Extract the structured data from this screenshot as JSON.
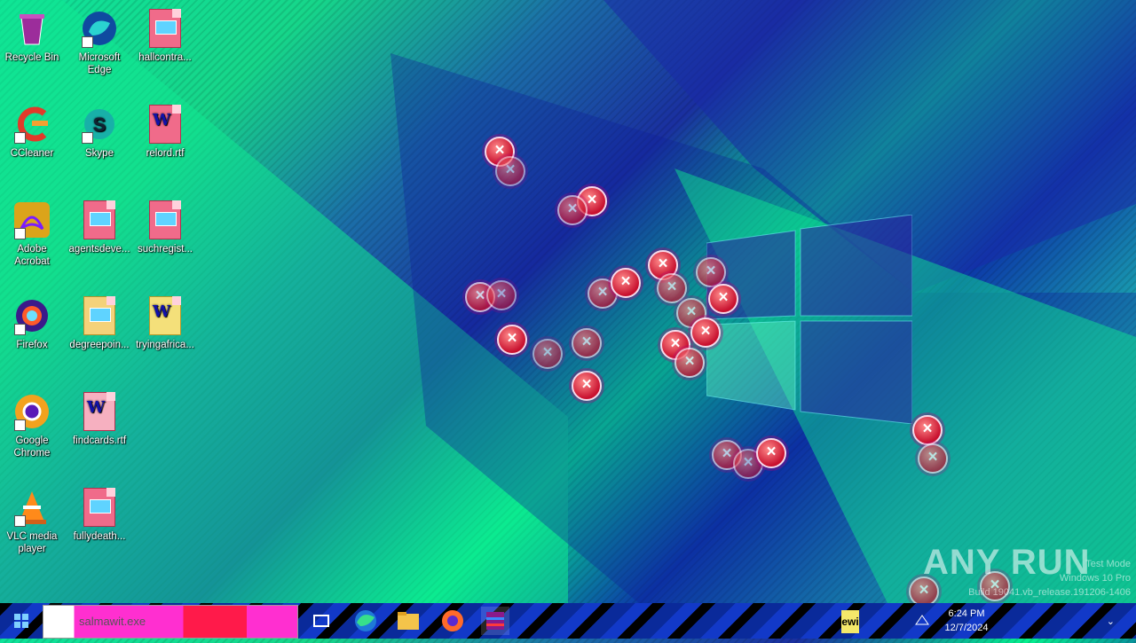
{
  "desktop": {
    "icons": [
      {
        "label": "Recycle Bin"
      },
      {
        "label": "Microsoft Edge"
      },
      {
        "label": "hallcontra..."
      },
      {
        "label": "CCleaner"
      },
      {
        "label": "Skype"
      },
      {
        "label": "relord.rtf"
      },
      {
        "label": "Adobe Acrobat"
      },
      {
        "label": "agentsdeve..."
      },
      {
        "label": "suchregist..."
      },
      {
        "label": "Firefox"
      },
      {
        "label": "degreepoin..."
      },
      {
        "label": "tryingafrica..."
      },
      {
        "label": "Google Chrome"
      },
      {
        "label": "findcards.rtf"
      },
      {
        "label": "VLC media player"
      },
      {
        "label": "fullydeath..."
      }
    ],
    "error_symbol": "×"
  },
  "taskbar": {
    "search_placeholder": "salmawit.exe",
    "pinned": [
      "task-view",
      "microsoft-edge",
      "file-explorer",
      "firefox",
      "winrar"
    ],
    "tray_label": "ewi",
    "time": "6:24 PM",
    "date": "12/7/2024"
  },
  "watermark": {
    "text": "ANY RUN",
    "mode_line": "Test Mode",
    "os_line": "Windows 10 Pro",
    "build_line": "Build 19041.vb_release.191206-1406"
  },
  "colors": {
    "accent_green": "#0df089",
    "accent_blue": "#1a2fa0",
    "error_red": "#c8102e"
  }
}
